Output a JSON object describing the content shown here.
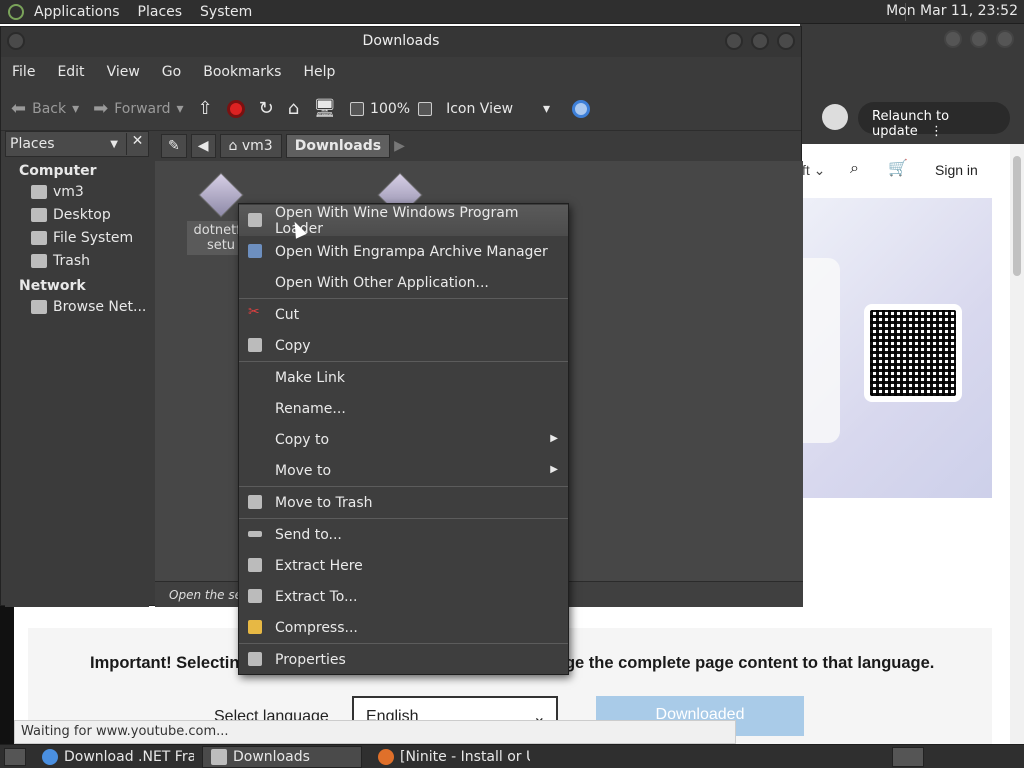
{
  "top_panel": {
    "menus": [
      "Applications",
      "Places",
      "System"
    ],
    "clock": "Mon Mar 11, 23:52"
  },
  "browser": {
    "relaunch_label": "Relaunch to update",
    "nav_fragment": "ft",
    "signin": "Sign in",
    "notice_text": "Important! Selecting a language below will dynamically change the complete page content to that language.",
    "select_language_label": "Select language",
    "language_value": "English",
    "download_button": "Downloaded",
    "status_text": "Waiting for www.youtube.com..."
  },
  "file_manager": {
    "title": "Downloads",
    "menubar": [
      "File",
      "Edit",
      "View",
      "Go",
      "Bookmarks",
      "Help"
    ],
    "toolbar": {
      "back": "Back",
      "forward": "Forward",
      "zoom": "100%",
      "view_mode": "Icon View"
    },
    "sidebar": {
      "selector": "Places",
      "sections": [
        {
          "heading": "Computer",
          "items": [
            "vm3",
            "Desktop",
            "File System",
            "Trash"
          ]
        },
        {
          "heading": "Network",
          "items": [
            "Browse Net..."
          ]
        }
      ]
    },
    "path": [
      "vm3",
      "Downloads"
    ],
    "files": [
      {
        "label": "dotnetfx setu"
      }
    ],
    "statusbar": "Open the selected item with \"Wine Windows Program Loader\""
  },
  "context_menu": {
    "items": [
      {
        "label": "Open With Wine Windows Program Loader",
        "icon": "wine-icon",
        "highlighted": true
      },
      {
        "label": "Open With Engrampa Archive Manager",
        "icon": "archive-manager-icon"
      },
      {
        "label": "Open With Other Application...",
        "icon": ""
      },
      {
        "sep": true
      },
      {
        "label": "Cut",
        "icon": "scissors-icon"
      },
      {
        "label": "Copy",
        "icon": "copy-icon"
      },
      {
        "sep": true
      },
      {
        "label": "Make Link",
        "icon": ""
      },
      {
        "label": "Rename...",
        "icon": ""
      },
      {
        "label": "Copy to",
        "icon": "",
        "submenu": true
      },
      {
        "label": "Move to",
        "icon": "",
        "submenu": true
      },
      {
        "sep": true
      },
      {
        "label": "Move to Trash",
        "icon": "trash-icon"
      },
      {
        "sep": true
      },
      {
        "label": "Send to...",
        "icon": "send-icon"
      },
      {
        "label": "Extract Here",
        "icon": "extract-icon"
      },
      {
        "label": "Extract To...",
        "icon": "extract-to-icon"
      },
      {
        "label": "Compress...",
        "icon": "compress-icon"
      },
      {
        "sep": true
      },
      {
        "label": "Properties",
        "icon": "properties-icon"
      }
    ]
  },
  "taskbar": {
    "tasks": [
      {
        "label": "Download .NET Fra...",
        "icon": "chrome-icon",
        "color": "#4a8fe0"
      },
      {
        "label": "Downloads",
        "icon": "folder-icon",
        "color": "#bdbdbd",
        "active": true
      },
      {
        "label": "[Ninite - Install or U...",
        "icon": "firefox-icon",
        "color": "#e0702a"
      }
    ]
  }
}
